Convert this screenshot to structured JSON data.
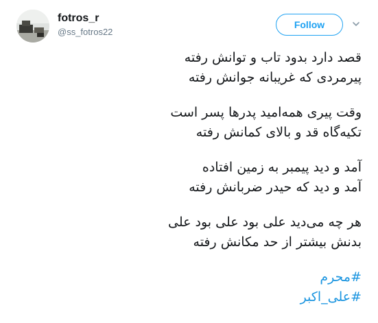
{
  "user": {
    "display_name": "fotros_r",
    "handle": "@ss_fotros22"
  },
  "actions": {
    "follow_label": "Follow"
  },
  "icons": {
    "avatar": "profile-photo",
    "more": "chevron-down-icon"
  },
  "colors": {
    "accent": "#1da1f2",
    "hashtag": "#1b95e0",
    "text": "#14171a",
    "muted": "#657786"
  },
  "tweet": {
    "stanzas": [
      [
        "قصد دارد بدود تاب و توانش رفته",
        "پیرمردی که غریبانه جوانش رفته"
      ],
      [
        "وقت پیری همه‌امید پدرها پسر است",
        "تکیه‌گاه قد و بالای کمانش رفته"
      ],
      [
        "آمد و دید پیمبر به زمین افتاده",
        "آمد و دید که حیدر ضربانش رفته"
      ],
      [
        "هر چه می‌دید علی بود علی بود علی",
        "بدنش بیشتر از حد مکانش رفته"
      ]
    ],
    "hashtags": [
      "#محرم",
      "#علی_اکبر"
    ]
  }
}
